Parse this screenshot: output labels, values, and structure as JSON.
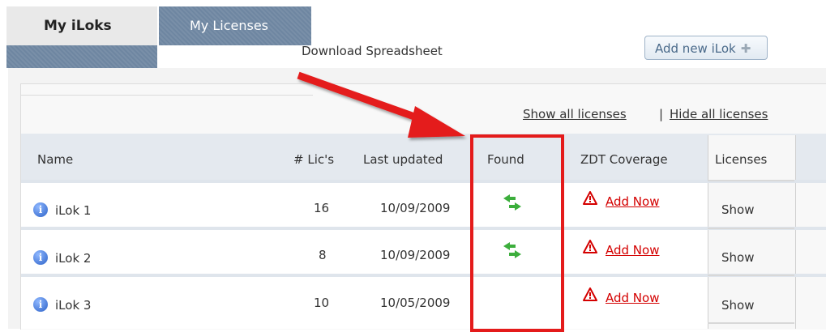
{
  "tabs": [
    {
      "label": "My iLoks",
      "active": false
    },
    {
      "label": "My Licenses",
      "active": true
    }
  ],
  "toolbar": {
    "download_label": "Download Spreadsheet",
    "add_button_label": "Add new iLok",
    "add_button_icon": "plus-icon"
  },
  "filters": {
    "show_all": "Show all licenses",
    "separator": "|",
    "hide_all": "Hide all licenses"
  },
  "table": {
    "headers": [
      "Name",
      "# Lic's",
      "Last updated",
      "Found",
      "ZDT Coverage",
      "Licenses"
    ],
    "rows": [
      {
        "name": "iLok 1",
        "lics": "16",
        "updated": "10/09/2009",
        "found": true,
        "zdt": "Add Now",
        "licenses": "Show"
      },
      {
        "name": "iLok 2",
        "lics": "8",
        "updated": "10/09/2009",
        "found": true,
        "zdt": "Add Now",
        "licenses": "Show"
      },
      {
        "name": "iLok 3",
        "lics": "10",
        "updated": "10/05/2009",
        "found": false,
        "zdt": "Add Now",
        "licenses": "Show"
      }
    ]
  },
  "annotation": {
    "highlight_color": "#e41b1b",
    "highlight_target": "Found column"
  },
  "colors": {
    "tab_active_bg": "#6e86a1",
    "link_red": "#d40000",
    "found_green": "#3cae3c",
    "info_blue": "#2d62c8"
  }
}
